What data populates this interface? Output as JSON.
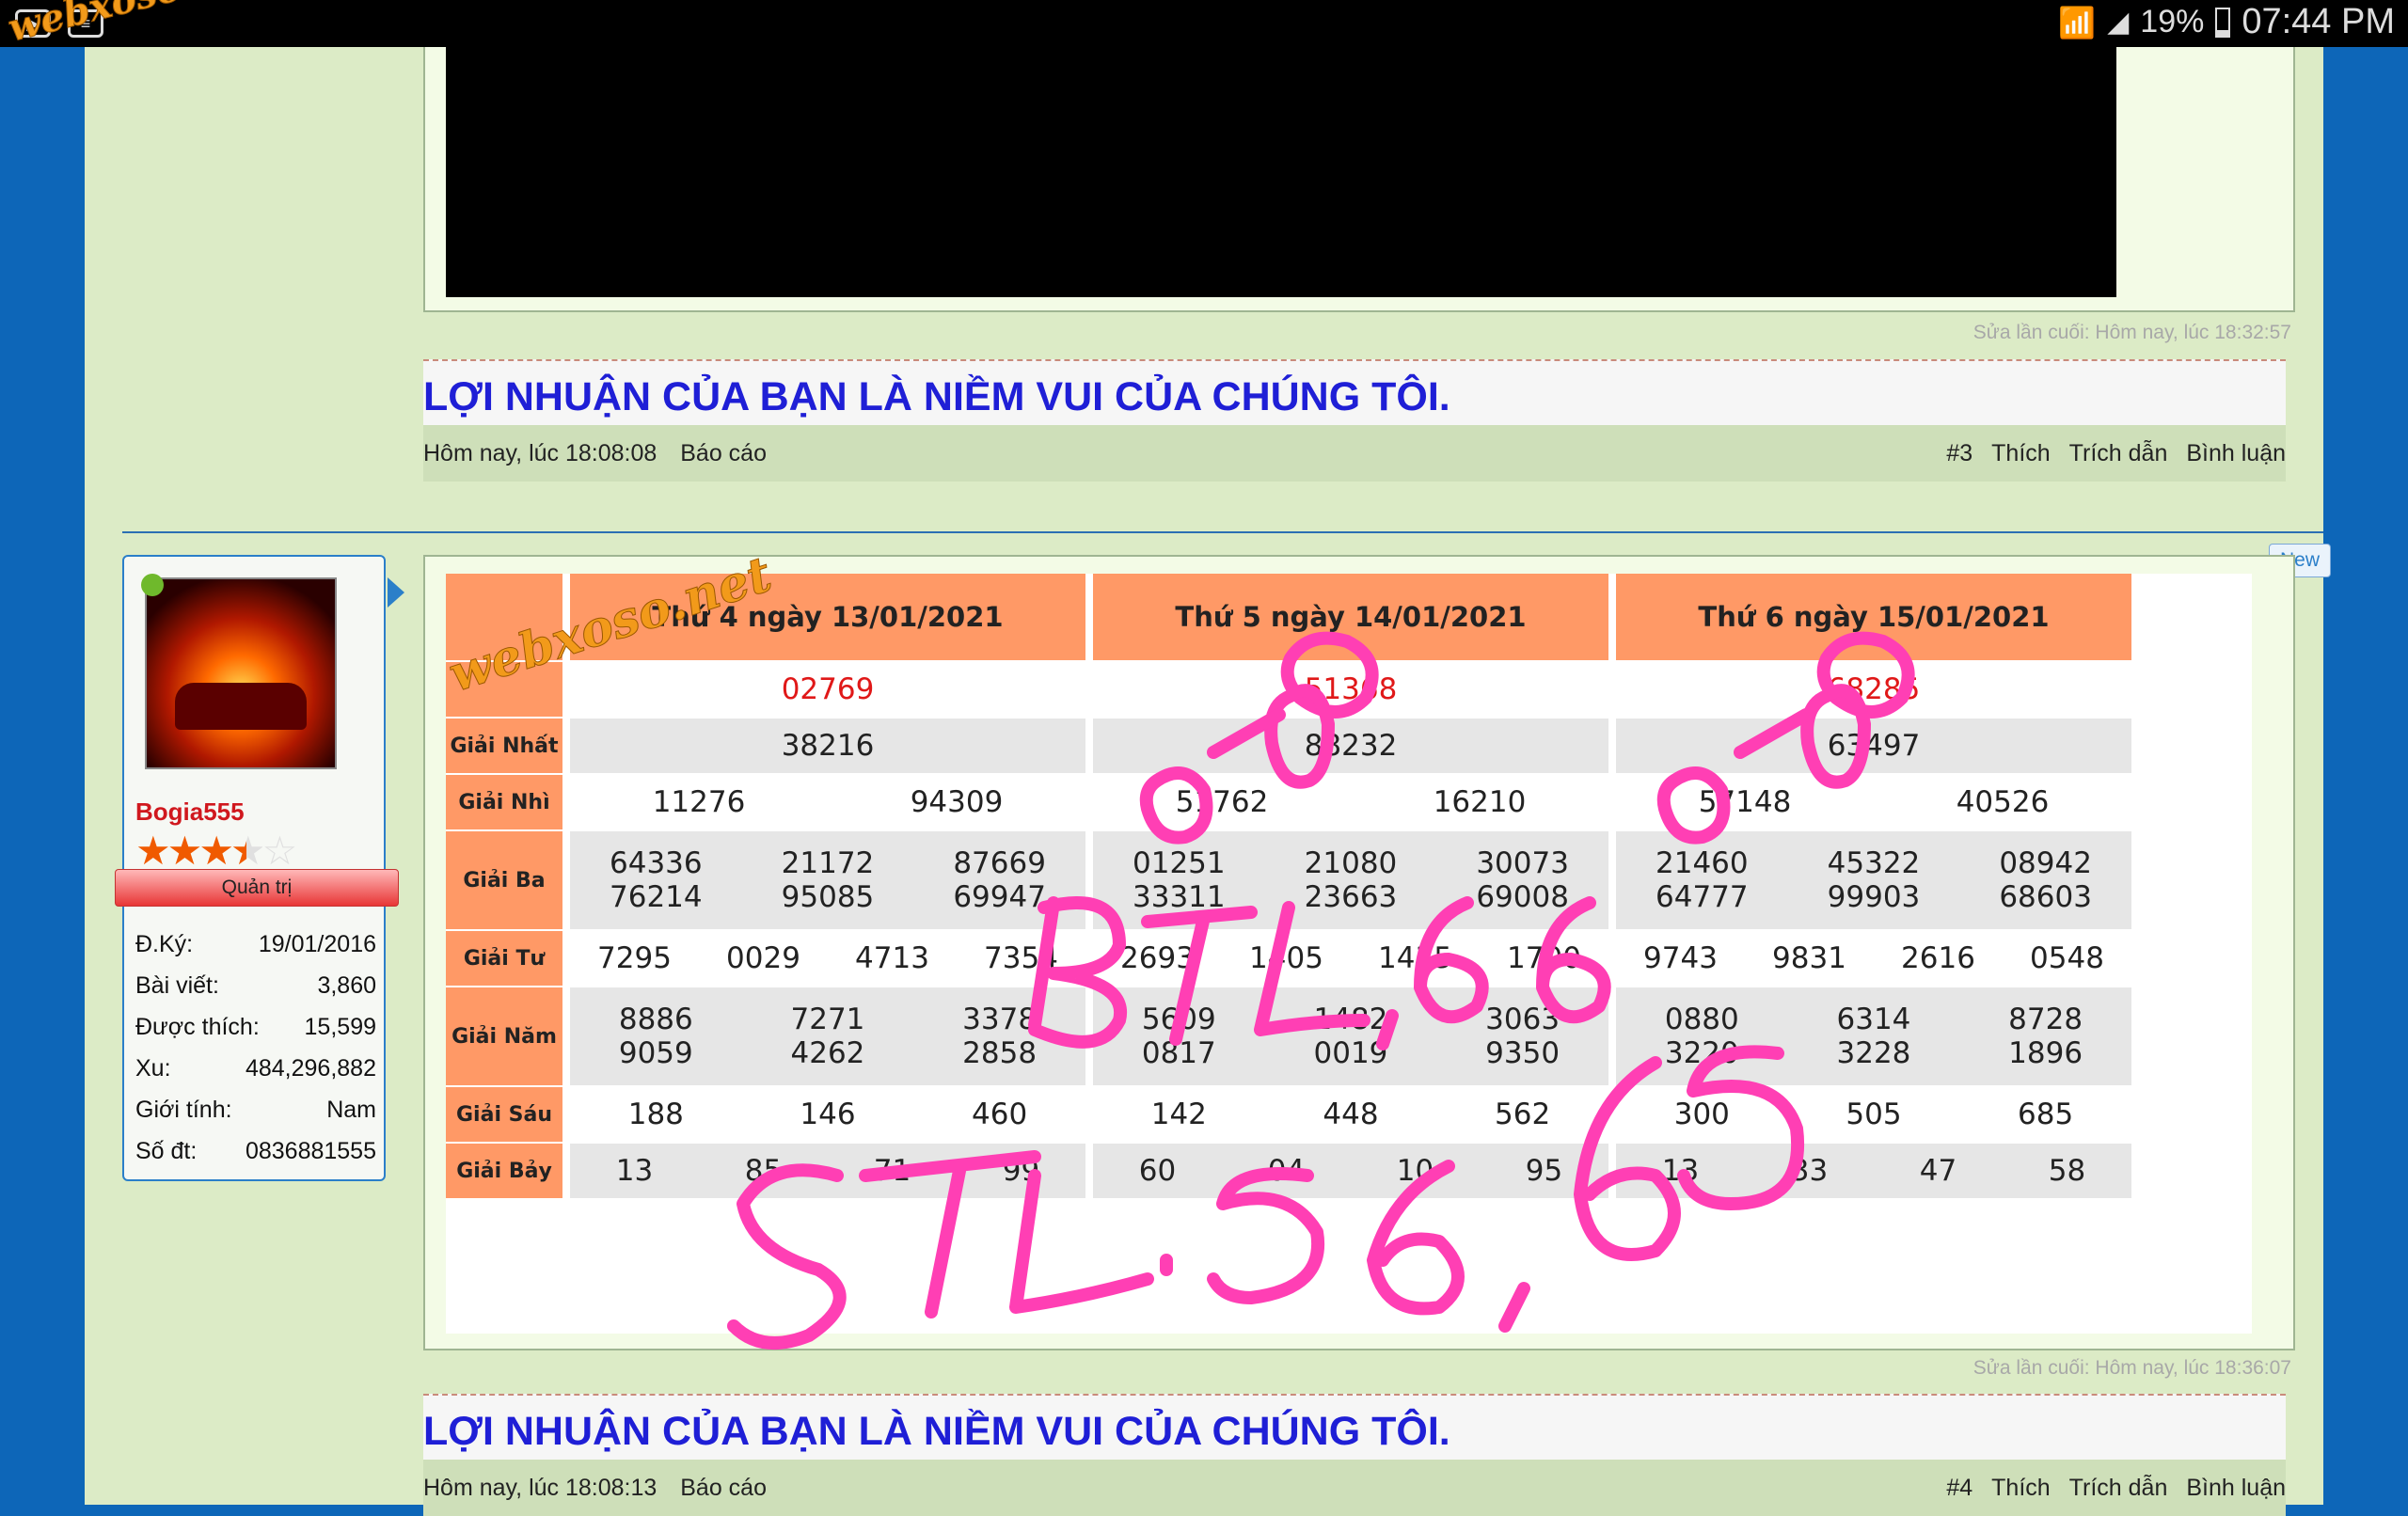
{
  "status_bar": {
    "battery": "19%",
    "time": "07:44 PM"
  },
  "watermark": "webxoso.net",
  "post1": {
    "edited": "Sửa lần cuối: Hôm nay, lúc 18:32:57",
    "signature": "LỢI NHUẬN CỦA BẠN LÀ NIỀM VUI CỦA CHÚNG TÔI.",
    "timestamp": "Hôm nay, lúc 18:08:08",
    "report": "Báo cáo",
    "post_number": "#3",
    "like": "Thích",
    "quote": "Trích dẫn",
    "comment": "Bình luận"
  },
  "user": {
    "name": "Bogia555",
    "rating": 3.5,
    "role": "Quản trị",
    "stats": [
      {
        "label": "Đ.Ký:",
        "value": "19/01/2016"
      },
      {
        "label": "Bài viết:",
        "value": "3,860"
      },
      {
        "label": "Được thích:",
        "value": "15,599"
      },
      {
        "label": "Xu:",
        "value": "484,296,882"
      },
      {
        "label": "Giới tính:",
        "value": "Nam"
      },
      {
        "label": "Số đt:",
        "value": "0836881555"
      }
    ]
  },
  "new_badge": "New",
  "lottery": {
    "row_labels": [
      "",
      "Giải Nhất",
      "Giải Nhì",
      "Giải Ba",
      "Giải Tư",
      "Giải Năm",
      "Giải Sáu",
      "Giải Bảy"
    ],
    "days": [
      {
        "header": "Thứ 4 ngày 13/01/2021",
        "special": "02769",
        "g1": [
          "38216"
        ],
        "g2": [
          "11276",
          "94309"
        ],
        "g3": [
          "64336",
          "21172",
          "87669",
          "76214",
          "95085",
          "69947"
        ],
        "g4": [
          "7295",
          "0029",
          "4713",
          "7354"
        ],
        "g5": [
          "8886",
          "7271",
          "3378",
          "9059",
          "4262",
          "2858"
        ],
        "g6": [
          "188",
          "146",
          "460"
        ],
        "g7": [
          "13",
          "85",
          "71",
          "99"
        ]
      },
      {
        "header": "Thứ 5 ngày 14/01/2021",
        "special": "51368",
        "g1": [
          "88232"
        ],
        "g2": [
          "51762",
          "16210"
        ],
        "g3": [
          "01251",
          "21080",
          "30073",
          "33311",
          "23663",
          "69008"
        ],
        "g4": [
          "2693",
          "1405",
          "1435",
          "1700"
        ],
        "g5": [
          "5609",
          "1482",
          "3063",
          "0817",
          "0019",
          "9350"
        ],
        "g6": [
          "142",
          "448",
          "562"
        ],
        "g7": [
          "60",
          "04",
          "10",
          "95"
        ]
      },
      {
        "header": "Thứ 6 ngày 15/01/2021",
        "special": "68285",
        "g1": [
          "63497"
        ],
        "g2": [
          "57148",
          "40526"
        ],
        "g3": [
          "21460",
          "45322",
          "08942",
          "64777",
          "99903",
          "68603"
        ],
        "g4": [
          "9743",
          "9831",
          "2616",
          "0548"
        ],
        "g5": [
          "0880",
          "6314",
          "8728",
          "3220",
          "3228",
          "1896"
        ],
        "g6": [
          "300",
          "505",
          "685"
        ],
        "g7": [
          "13",
          "33",
          "47",
          "58"
        ]
      }
    ]
  },
  "handwriting": {
    "line1": "BTL 66",
    "line2": "STL. 56, 65",
    "color": "#ff3fb4"
  },
  "post2": {
    "edited": "Sửa lần cuối: Hôm nay, lúc 18:36:07",
    "signature": "LỢI NHUẬN CỦA BẠN LÀ NIỀM VUI CỦA CHÚNG TÔI.",
    "timestamp": "Hôm nay, lúc 18:08:13",
    "report": "Báo cáo",
    "post_number": "#4",
    "like": "Thích",
    "quote": "Trích dẫn",
    "comment": "Bình luận"
  }
}
